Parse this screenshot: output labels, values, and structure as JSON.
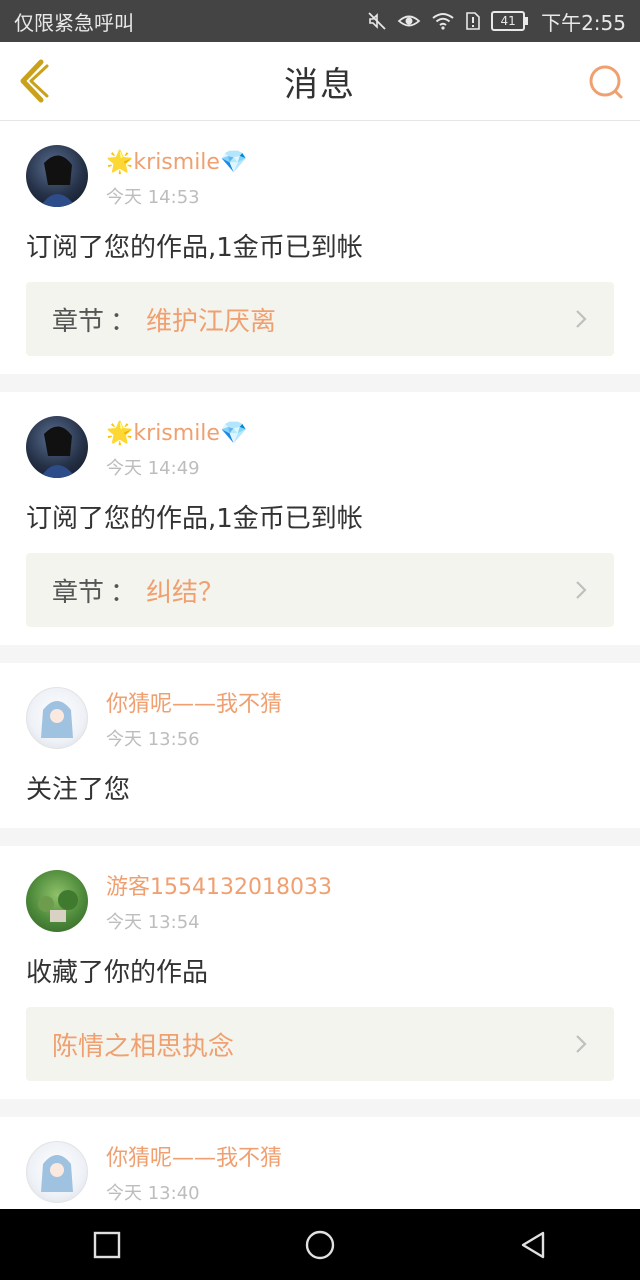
{
  "status_bar": {
    "left_text": "仅限紧急呼叫",
    "battery_level": "41",
    "time": "下午2:55"
  },
  "nav": {
    "title": "消息",
    "back_icon": "back-chevron-icon",
    "search_icon": "search-icon"
  },
  "colors": {
    "accent": "#f0a070",
    "back": "#c9a21a"
  },
  "messages": [
    {
      "username": "krismile",
      "prefix_emoji": "🌟",
      "suffix_emoji": "💎",
      "time": "今天 14:53",
      "text": "订阅了您的作品,1金币已到帐",
      "chapter_label": "章节",
      "chapter_sep": "：",
      "chapter_name": "维护江厌离"
    },
    {
      "username": "krismile",
      "prefix_emoji": "🌟",
      "suffix_emoji": "💎",
      "time": "今天 14:49",
      "text": "订阅了您的作品,1金币已到帐",
      "chapter_label": "章节",
      "chapter_sep": "：",
      "chapter_name": "纠结？"
    },
    {
      "username": "你猜呢——我不猜",
      "time": "今天 13:56",
      "text": "关注了您"
    },
    {
      "username": "游客1554132018033",
      "time": "今天 13:54",
      "text": "收藏了你的作品",
      "work_name": "陈情之相思执念"
    },
    {
      "username": "你猜呢——我不猜",
      "time": "今天 13:40"
    }
  ],
  "system_nav": [
    "recent-apps-icon",
    "home-icon",
    "back-triangle-icon"
  ]
}
